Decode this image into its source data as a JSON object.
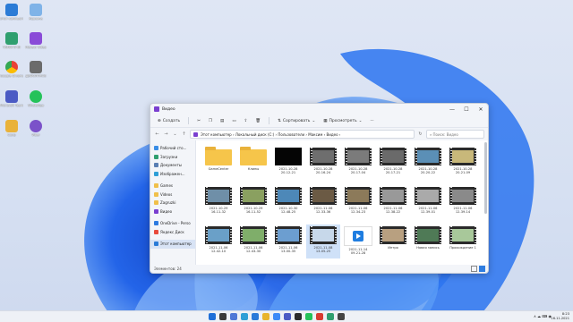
{
  "desktop": {
    "icons": [
      {
        "label": "Этот компьютер",
        "color": "#2b7bd6"
      },
      {
        "label": "Корзина",
        "color": "#7fb3e8"
      },
      {
        "label": "ТАМАГОЧИ",
        "color": "#2f9f6f"
      },
      {
        "label": "Movavi Video",
        "color": "#8a4bd8"
      },
      {
        "label": "Google Chrome",
        "color": "#e94235"
      },
      {
        "label": "ДЕФОЛТНОЕ",
        "color": "#6b6b6b"
      },
      {
        "label": "Microsoft Teams",
        "color": "#4b5bc4"
      },
      {
        "label": "WhatsApp",
        "color": "#25c25a"
      },
      {
        "label": "Сохр",
        "color": "#e9b23a"
      },
      {
        "label": "Viber",
        "color": "#7b52c9"
      }
    ]
  },
  "window": {
    "title": "Видео",
    "controls": {
      "minimize": "—",
      "maximize": "☐",
      "close": "✕"
    },
    "toolbar": {
      "create": "Создать",
      "sort": "Сортировать",
      "view": "Просмотреть",
      "more": "···"
    },
    "address": "Этот компьютер  ›  Локальный диск (C:)  ›  Пользователи  ›  Максим  ›  Видео  ›",
    "search_placeholder": "Поиск: Видео",
    "sidebar": [
      {
        "label": "Рабочий сто...",
        "color": "#3a8ee6"
      },
      {
        "label": "Загрузки",
        "color": "#2f9f6f"
      },
      {
        "label": "Документы",
        "color": "#5a7fb3"
      },
      {
        "label": "Изображен...",
        "color": "#2f9fd6"
      },
      {
        "label": "Games",
        "color": "#f0c04a"
      },
      {
        "label": "Videos",
        "color": "#f0c04a"
      },
      {
        "label": "Zagruzki",
        "color": "#f0c04a"
      },
      {
        "label": "Видео",
        "color": "#7a3fd0"
      },
      {
        "label": "OneDrive - Perso",
        "color": "#2e7be0"
      },
      {
        "label": "Яндекс Диск",
        "color": "#e84a3b"
      },
      {
        "label": "Этот компьютер",
        "color": "#2b7bd6"
      }
    ],
    "status": "Элементов: 24",
    "files": [
      {
        "name": "GameCenter",
        "kind": "folder",
        "c": "#f6c54a"
      },
      {
        "name": "Клипы",
        "kind": "folder",
        "c": "#f6c54a"
      },
      {
        "name": "2021-10-28\n20-12-21",
        "kind": "dark",
        "c": "#050505"
      },
      {
        "name": "2021-10-28\n20-16-24",
        "kind": "film",
        "c": "#6e6e6e"
      },
      {
        "name": "2021-10-28\n20-17-04",
        "kind": "film",
        "c": "#7b7b7b"
      },
      {
        "name": "2021-10-28\n20-17-21",
        "kind": "film",
        "c": "#6a6a6a"
      },
      {
        "name": "2021-10-28\n20-20-22",
        "kind": "film",
        "c": "#5b8fb6"
      },
      {
        "name": "2021-10-28\n20-21-09",
        "kind": "film",
        "c": "#c8b87a"
      },
      {
        "name": "2021-10-29\n16-11-32",
        "kind": "film",
        "c": "#6f8fa8"
      },
      {
        "name": "2021-10-29\n16-11-52",
        "kind": "film",
        "c": "#8aa060"
      },
      {
        "name": "2021-10-30\n12-48-25",
        "kind": "film",
        "c": "#4d88b8"
      },
      {
        "name": "2021-11-06\n12-33-36",
        "kind": "film",
        "c": "#6b5a44"
      },
      {
        "name": "2021-11-06\n12-34-23",
        "kind": "film",
        "c": "#8c7a5a"
      },
      {
        "name": "2021-11-06\n12-38-22",
        "kind": "film",
        "c": "#999999"
      },
      {
        "name": "2021-11-06\n12-39-01",
        "kind": "film",
        "c": "#aaaaaa"
      },
      {
        "name": "2021-11-06\n12-39-14",
        "kind": "film",
        "c": "#8a8a8a"
      },
      {
        "name": "2021-11-06\n12-42-10",
        "kind": "film",
        "c": "#6aa0c8"
      },
      {
        "name": "2021-11-06\n12-43-30",
        "kind": "film",
        "c": "#7fae6a"
      },
      {
        "name": "2021-11-06\n13-00-35",
        "kind": "film",
        "c": "#6c9ed0"
      },
      {
        "name": "2021-11-08\n13-05-25",
        "kind": "film",
        "c": "#c7d8ea",
        "selected": true
      },
      {
        "name": "2021-11-14\n09-21-28",
        "kind": "vid",
        "c": "#1f7de0"
      },
      {
        "name": "Интро",
        "kind": "film",
        "c": "#b8a080"
      },
      {
        "name": "Новая запись",
        "kind": "film",
        "c": "#4f7a56"
      },
      {
        "name": "Прохождение 1",
        "kind": "film",
        "c": "#a8c89a"
      }
    ]
  },
  "taskbar": {
    "apps": [
      "#1f6fd8",
      "#3a3a3a",
      "#4f78d6",
      "#2f9fd6",
      "#2a7ad9",
      "#e8b42c",
      "#3d8af7",
      "#4b5bc4",
      "#2b2b2b",
      "#25c25a",
      "#d83b30",
      "#2f9f6f",
      "#444444"
    ],
    "tray_icons": "∧ ☁ ⌨ ◉",
    "time": "8:23",
    "date": "16.11.2021"
  }
}
